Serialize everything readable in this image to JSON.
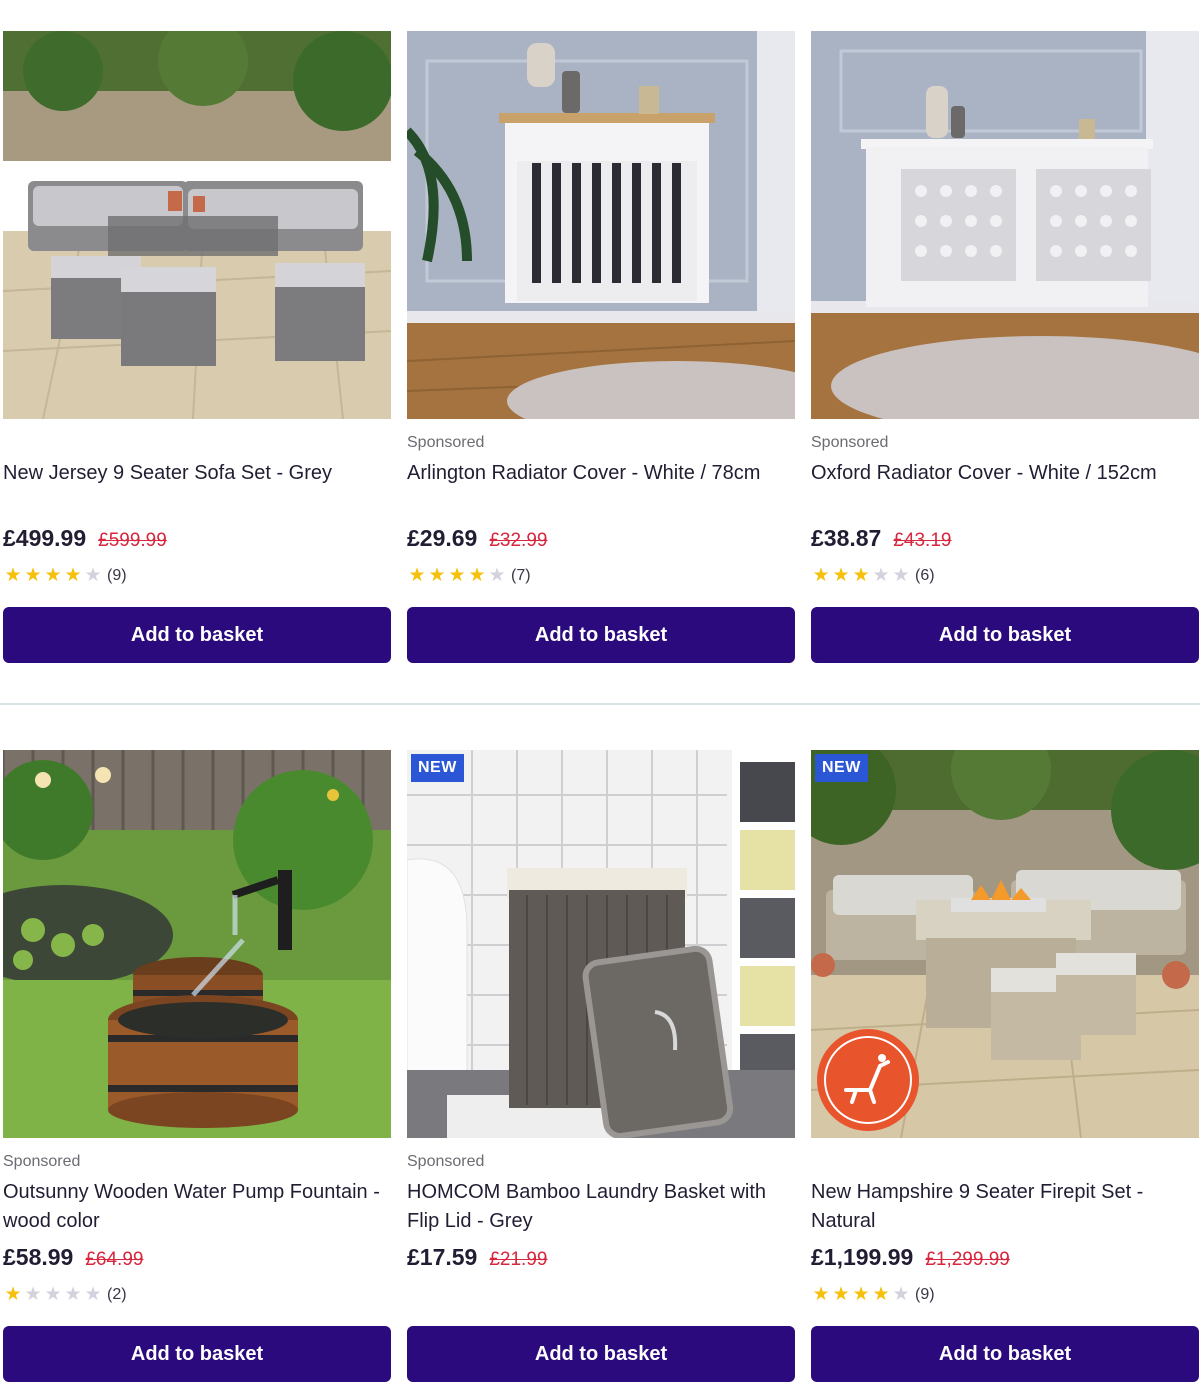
{
  "products": [
    {
      "sponsored": "",
      "title": "New Jersey 9 Seater Sofa Set - Grey",
      "price": "£499.99",
      "was_price": "£599.99",
      "rating": 4,
      "review_count": "(9)",
      "button": "Add to basket",
      "badge": ""
    },
    {
      "sponsored": "Sponsored",
      "title": "Arlington Radiator Cover - White / 78cm",
      "price": "£29.69",
      "was_price": "£32.99",
      "rating": 4,
      "review_count": "(7)",
      "button": "Add to basket",
      "badge": ""
    },
    {
      "sponsored": "Sponsored",
      "title": "Oxford Radiator Cover - White / 152cm",
      "price": "£38.87",
      "was_price": "£43.19",
      "rating": 3,
      "review_count": "(6)",
      "button": "Add to basket",
      "badge": ""
    },
    {
      "sponsored": "Sponsored",
      "title": "Outsunny Wooden Water Pump Fountain - wood color",
      "price": "£58.99",
      "was_price": "£64.99",
      "rating": 1,
      "review_count": "(2)",
      "button": "Add to basket",
      "badge": ""
    },
    {
      "sponsored": "Sponsored",
      "title": "HOMCOM Bamboo Laundry Basket with Flip Lid - Grey",
      "price": "£17.59",
      "was_price": "£21.99",
      "rating": 0,
      "review_count": "",
      "button": "Add to basket",
      "badge": "NEW"
    },
    {
      "sponsored": "",
      "title": "New Hampshire 9 Seater Firepit Set - Natural",
      "price": "£1,199.99",
      "was_price": "£1,299.99",
      "rating": 4,
      "review_count": "(9)",
      "button": "Add to basket",
      "badge": "NEW",
      "stamp_text": "I RECLINE"
    }
  ],
  "colors": {
    "button": "#2a0a7c",
    "star_on": "#f6c10c",
    "star_off": "#d2d3dc",
    "was_price": "#d7263d",
    "badge_new": "#2b56d6"
  }
}
